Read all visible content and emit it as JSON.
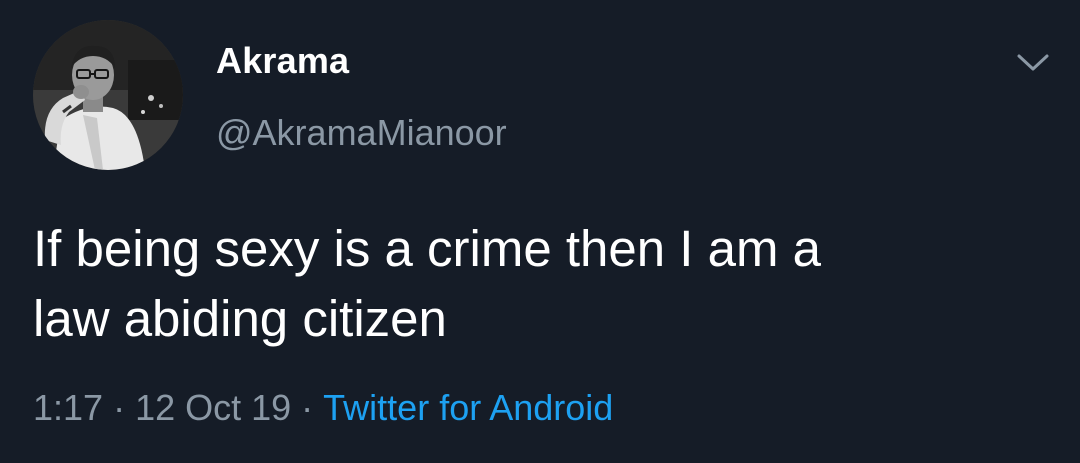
{
  "tweet": {
    "author": {
      "display_name": "Akrama",
      "handle": "@AkramaMianoor",
      "avatar": "profile-photo"
    },
    "text_lines": [
      "If being sexy is a crime then I am a",
      "law abiding citizen"
    ],
    "time": "1:17",
    "separator": "·",
    "date": "12 Oct 19",
    "source": "Twitter for Android",
    "menu_icon": "chevron-down-icon"
  },
  "colors": {
    "background": "#151c27",
    "primary_text": "#ffffff",
    "secondary_text": "#8b98a5",
    "link": "#1da1f2"
  }
}
